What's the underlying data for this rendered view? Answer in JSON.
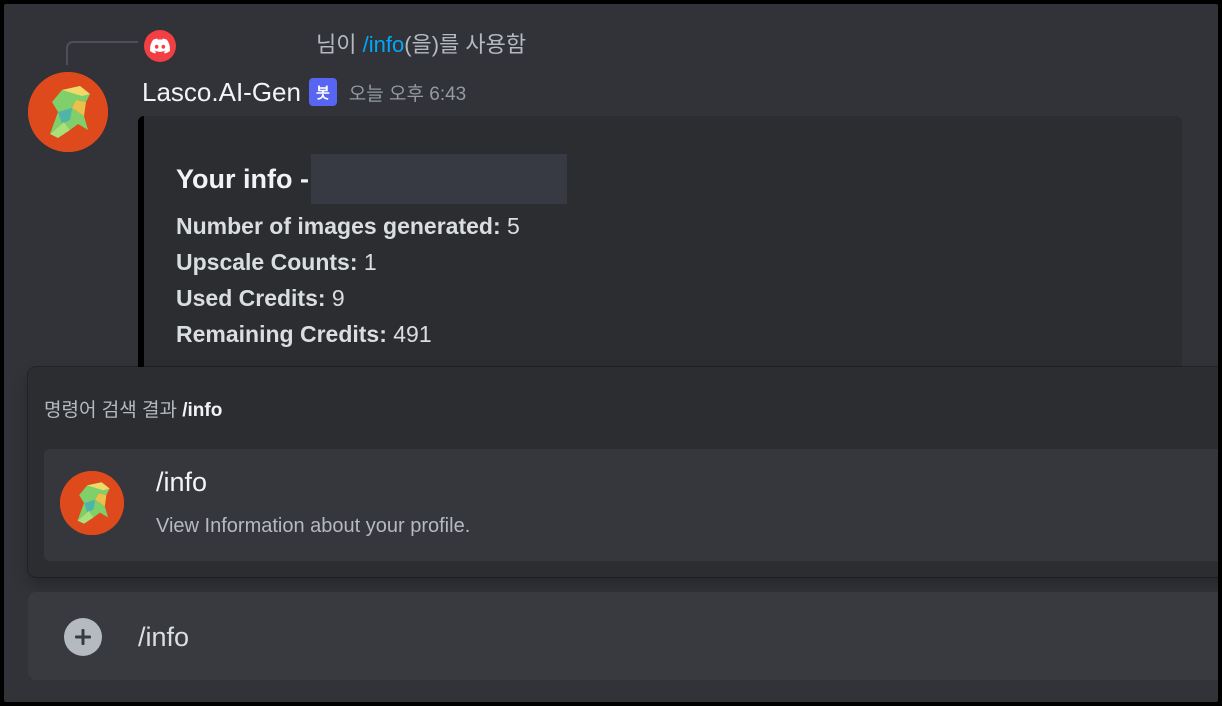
{
  "reply": {
    "prefix": "님이 ",
    "command": "/info",
    "suffix": "(을)를 사용함"
  },
  "message": {
    "author": "Lasco.AI-Gen",
    "bot_tag": "봇",
    "timestamp": "오늘 오후 6:43",
    "embed": {
      "title": "Your info - ",
      "stats": [
        {
          "label": "Number of images generated:",
          "value": " 5"
        },
        {
          "label": "Upscale Counts:",
          "value": " 1"
        },
        {
          "label": "Used Credits:",
          "value": " 9"
        },
        {
          "label": "Remaining Credits:",
          "value": " 491"
        }
      ]
    }
  },
  "autocomplete": {
    "header_prefix": "명령어 검색 결과 ",
    "header_query": "/info",
    "item": {
      "name": "/info",
      "description": "View Information about your profile."
    }
  },
  "composer": {
    "value": "/info"
  },
  "colors": {
    "background": "#313338",
    "embed_bg": "#2b2d31",
    "bot_tag": "#5865f2",
    "command_link": "#00a8fc",
    "discord_red": "#f23f43"
  }
}
